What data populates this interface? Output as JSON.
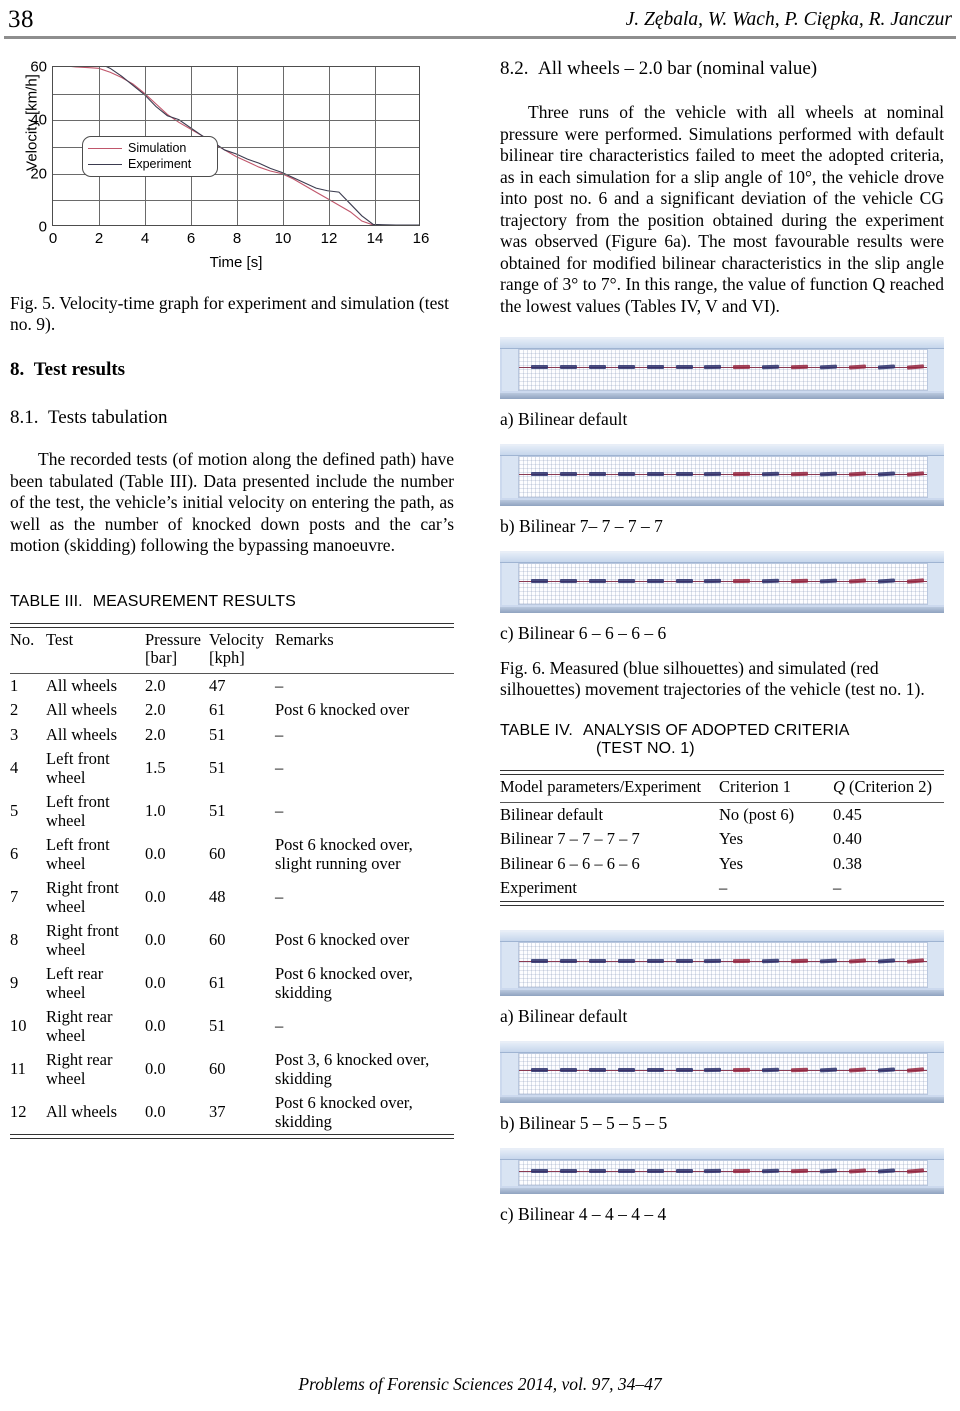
{
  "running_head": {
    "page_number": "38",
    "authors": "J. Zębala, W. Wach, P. Ciępka, R. Janczur"
  },
  "left_column": {
    "figure5": {
      "caption": "Fig. 5. Velocity-time graph for experiment and simulation (test no. 9)."
    },
    "section8": {
      "number": "8.",
      "title": "Test results"
    },
    "section81": {
      "number": "8.1.",
      "title": "Tests tabulation"
    },
    "paragraph": "The recorded tests (of motion along the defined path) have been tabulated (Table III). Data presented include the number of the test, the vehicle’s initial velocity on entering the path, as well as the number of knocked down posts and the car’s motion (skidding) following the bypassing manoeuvre.",
    "table3": {
      "label": "TABLE III.",
      "title": "MEASUREMENT RESULTS",
      "columns": [
        "No.",
        "Test",
        "Pressure [bar]",
        "Velocity [kph]",
        "Remarks"
      ],
      "column_headers": [
        {
          "line1": "No.",
          "line2": ""
        },
        {
          "line1": "Test",
          "line2": ""
        },
        {
          "line1": "Pressure",
          "line2": "[bar]"
        },
        {
          "line1": "Velocity",
          "line2": "[kph]"
        },
        {
          "line1": "Remarks",
          "line2": ""
        }
      ],
      "rows": [
        {
          "no": "1",
          "test": "All wheels",
          "pressure": "2.0",
          "velocity": "47",
          "remarks": "–"
        },
        {
          "no": "2",
          "test": "All wheels",
          "pressure": "2.0",
          "velocity": "61",
          "remarks": "Post 6 knocked over"
        },
        {
          "no": "3",
          "test": "All wheels",
          "pressure": "2.0",
          "velocity": "51",
          "remarks": "–"
        },
        {
          "no": "4",
          "test": "Left front wheel",
          "pressure": "1.5",
          "velocity": "51",
          "remarks": "–"
        },
        {
          "no": "5",
          "test": "Left front wheel",
          "pressure": "1.0",
          "velocity": "51",
          "remarks": "–"
        },
        {
          "no": "6",
          "test": "Left front wheel",
          "pressure": "0.0",
          "velocity": "60",
          "remarks": "Post 6 knocked over, slight running over"
        },
        {
          "no": "7",
          "test": "Right front wheel",
          "pressure": "0.0",
          "velocity": "48",
          "remarks": "–"
        },
        {
          "no": "8",
          "test": "Right front wheel",
          "pressure": "0.0",
          "velocity": "60",
          "remarks": "Post 6 knocked over"
        },
        {
          "no": "9",
          "test": "Left rear wheel",
          "pressure": "0.0",
          "velocity": "61",
          "remarks": "Post 6 knocked over, skidding"
        },
        {
          "no": "10",
          "test": "Right rear wheel",
          "pressure": "0.0",
          "velocity": "51",
          "remarks": "–"
        },
        {
          "no": "11",
          "test": "Right rear wheel",
          "pressure": "0.0",
          "velocity": "60",
          "remarks": "Post 3, 6 knocked over, skidding"
        },
        {
          "no": "12",
          "test": "All wheels",
          "pressure": "0.0",
          "velocity": "37",
          "remarks": "Post 6 knocked over, skidding"
        }
      ]
    }
  },
  "right_column": {
    "section82": {
      "number": "8.2.",
      "title": "All wheels – 2.0 bar (nominal value)"
    },
    "paragraph": "Three runs of the vehicle with all wheels at nominal pressure were performed. Simulations performed with default bilinear tire characteristics failed to meet the adopted criteria, as in each simulation for a slip angle of 10°, the vehicle drove into post no. 6 and a significant deviation of the vehicle CG trajectory from the position obtained during the experiment was observed (Figure 6a). The most favourable results were obtained for modified bilinear characteristics in the slip angle range of 3° to 7°. In this range, the value of function Q reached the lowest values (Tables IV, V and VI).",
    "figure6": {
      "subcaptions": [
        "a) Bilinear default",
        "b) Bilinear 7– 7 – 7 – 7",
        "c) Bilinear 6 – 6 – 6 – 6"
      ],
      "caption": "Fig. 6. Measured (blue silhouettes) and simulated (red silhouettes) movement trajectories of the vehicle (test no. 1)."
    },
    "table4": {
      "label": "TABLE IV.",
      "title_line1": "ANALYSIS OF ADOPTED CRITERIA",
      "title_line2": "(TEST NO. 1)",
      "columns": [
        "Model parameters/Experiment",
        "Criterion 1",
        "Q (Criterion 2)"
      ],
      "col3_var": "Q",
      "col3_rest": " (Criterion 2)",
      "rows": [
        {
          "model": "Bilinear default",
          "criterion1": "No (post 6)",
          "q": "0.45"
        },
        {
          "model": "Bilinear 7 – 7 – 7 – 7",
          "criterion1": "Yes",
          "q": "0.40"
        },
        {
          "model": "Bilinear 6 – 6 – 6 – 6",
          "criterion1": "Yes",
          "q": "0.38"
        },
        {
          "model": "Experiment",
          "criterion1": "–",
          "q": "–"
        }
      ]
    },
    "figure7": {
      "subcaptions": [
        "a) Bilinear default",
        "b) Bilinear 5 – 5 – 5 – 5",
        "c) Bilinear 4 – 4 – 4 – 4"
      ]
    }
  },
  "footer": {
    "text": "Problems of Forensic Sciences 2014, vol. 97, 34–47"
  },
  "colors": {
    "simulation_line": "#c0566b",
    "experiment_line": "#3b3b4f",
    "axis": "#4d4d4d",
    "grid": "#6a6a6a",
    "rule": "#8e8e8e",
    "screenshot_frame": "#ccd9ee",
    "silhouette_measured": "#2a2f6b",
    "silhouette_simulated": "#94243e"
  },
  "chart_data": {
    "type": "line",
    "title": "",
    "xlabel": "Time [s]",
    "ylabel": "Velocity [km/h]",
    "xlim": [
      0,
      16
    ],
    "ylim": [
      0,
      60
    ],
    "xticks": [
      0,
      2,
      4,
      6,
      8,
      10,
      12,
      14,
      16
    ],
    "yticks": [
      0,
      20,
      40,
      60
    ],
    "gridlines_y": [
      0,
      10,
      20,
      30,
      40,
      50,
      60
    ],
    "gridlines_x": [
      0,
      2,
      4,
      6,
      8,
      10,
      12,
      14,
      16
    ],
    "grid": true,
    "legend_position": "center-left",
    "series": [
      {
        "name": "Simulation",
        "color": "#c0566b",
        "x": [
          0,
          0.5,
          1,
          1.5,
          2,
          2.5,
          3,
          3.5,
          4,
          4.5,
          5,
          5.5,
          6,
          6.5,
          7,
          7.5,
          8,
          8.5,
          9,
          9.5,
          10,
          10.5,
          11,
          11.5,
          12,
          12.5,
          13,
          13.5,
          14,
          15,
          16
        ],
        "y": [
          60.5,
          60.5,
          60,
          59.8,
          59.5,
          58,
          56,
          53.5,
          50,
          46,
          42,
          39,
          36.5,
          34,
          31,
          28.5,
          26,
          24,
          22,
          20.5,
          19.5,
          17.5,
          15,
          12.5,
          10,
          7.5,
          5,
          1.5,
          0,
          0,
          0
        ]
      },
      {
        "name": "Experiment",
        "color": "#3b3b4f",
        "x": [
          0,
          0.5,
          1,
          1.5,
          2,
          2.5,
          3,
          3.5,
          4,
          4.5,
          5,
          5.5,
          6,
          6.5,
          7,
          7.5,
          8,
          8.5,
          9,
          9.5,
          10,
          10.5,
          11,
          11.5,
          12,
          12.5,
          13,
          13.5,
          14,
          15,
          16
        ],
        "y": [
          63,
          62,
          61,
          60.5,
          61.5,
          59.5,
          56.5,
          53,
          49.5,
          45,
          41.5,
          40,
          37,
          34,
          31.5,
          28.5,
          27,
          25,
          23.5,
          21.5,
          20,
          18,
          16,
          14,
          13,
          12.5,
          8,
          3.5,
          0.2,
          0,
          0
        ]
      }
    ]
  }
}
